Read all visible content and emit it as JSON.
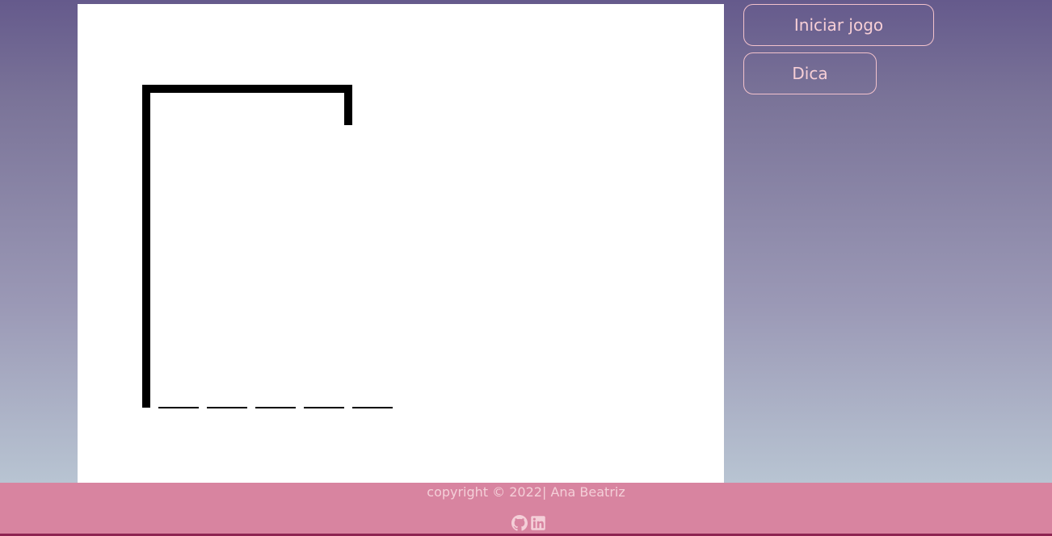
{
  "game": {
    "word_length": 5
  },
  "actions": {
    "start_label": "Iniciar jogo",
    "hint_label": "Dica"
  },
  "footer": {
    "copyright": "copyright © 2022| Ana Beatriz",
    "social_icons": [
      "github-icon",
      "linkedin-icon"
    ]
  },
  "colors": {
    "accent_text": "#f7cfd6",
    "footer_bg": "#d884a0",
    "gradient_top": "#655a8c",
    "gradient_bottom": "#b8c4d2"
  }
}
